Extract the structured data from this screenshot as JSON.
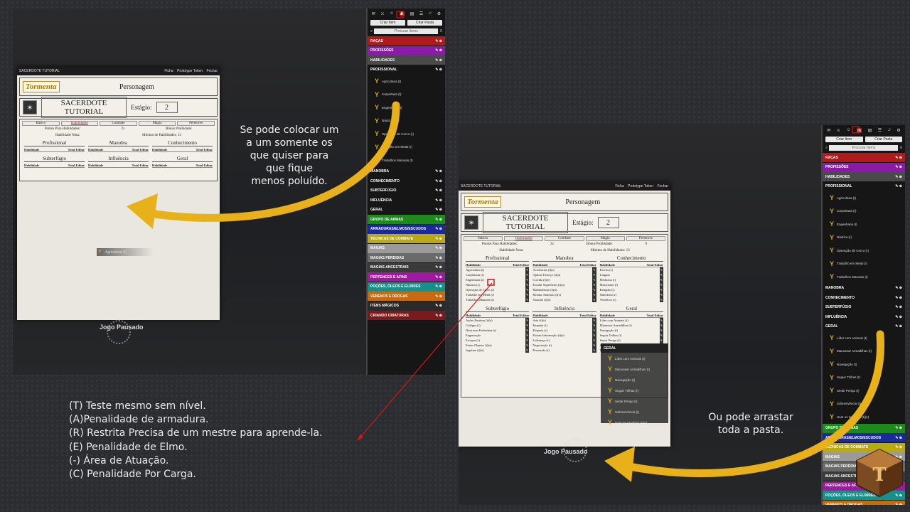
{
  "window": {
    "sheet_title": "SACERDOTE TUTORIAL",
    "actions": [
      "Ficha",
      "Prototype Token",
      "Fechar"
    ]
  },
  "sheet": {
    "logo": "Tormenta",
    "page_title": "Personagem",
    "char_name": "SACERDOTE TUTORIAL",
    "stage_label": "Estágio:",
    "stage_value": "2",
    "tabs": [
      "Básico",
      "Habilidades",
      "Combate",
      "Magia",
      "Pertences"
    ],
    "points_label": "Pontos Para Habilidades:",
    "points_value": "2x",
    "bonus_label": "Bônus Proibidade:",
    "bonus_value": "0",
    "skill_level_label": "Habilidade Nota:",
    "min_skills_label": "Mínimo de Habilidades: 13",
    "col_headers": [
      "Habilidade",
      "Total",
      "Editar"
    ],
    "groups": [
      {
        "title": "Profissional",
        "rows": [
          "Agricultura (t)",
          "Carpintaria (t)",
          "Engenharia (t)",
          "Náutica (r)",
          "Operação de Cerco (r)",
          "Trabalho em Metal (r)",
          "Trabalhos Manuais (t)"
        ]
      },
      {
        "title": "Manobra",
        "rows": [
          "Acrobacias (t)(a)",
          "Aplicar Esforço (t)(a)",
          "Corrida (t)(e)",
          "Escalar Superfícies (t)(a)",
          "Malabarismo (t)(a)",
          "Montar Animais (t)(e)",
          "Natação (t)(a)"
        ]
      },
      {
        "title": "Conhecimento",
        "rows": [
          "Escrita (r)",
          "Línguas",
          "Medicina (r)",
          "Musicismo (t)",
          "Religião (r)",
          "Sabedoria (r)",
          "Venefício (r)"
        ]
      },
      {
        "title": "Subterfúgio",
        "rows": [
          "Ações Furtivas (t)(a)",
          "Códigos (r)",
          "Destravar Fechadura (r)",
          "Engenração",
          "Escapar (r)",
          "Furtar Objetos (t)(a)",
          "Jogatina (t)(a)"
        ]
      },
      {
        "title": "Influência",
        "rows": [
          "Arte (t)(e)",
          "Empatia (t)",
          "Etiqueta (r)",
          "Extrair Informação (t)(e)",
          "Liderança (r)",
          "Negociação (t)",
          "Persuasão (t)"
        ]
      },
      {
        "title": "Geral",
        "rows": [
          "Líder com Animais (t)",
          "Manusear Armadilhas (t)",
          "Navegação (t)",
          "Seguir Trilhas (t)",
          "Sentir Perigo (t)",
          "Sobrevivência (t)",
          "Usar os Sentidos (t)"
        ]
      }
    ],
    "drag_item": "Agricultura (t)",
    "drag_folder": "GERAL"
  },
  "paused_text": "Jogo Pausado",
  "sidebar": {
    "create_item": "Criar Item",
    "create_folder": "Criar Pasta",
    "search_placeholder": "Procurar Items",
    "folders_top": [
      {
        "name": "RAÇAS",
        "color": "#b01a1a"
      },
      {
        "name": "PROFISSÕES",
        "color": "#8a1aa8"
      },
      {
        "name": "HABILIDADES",
        "color": "#4a4a4a"
      }
    ],
    "subfolder_open": "PROFISSIONAL",
    "professional_items": [
      "Agricultura (t)",
      "Carpintaria (t)",
      "Engenharia (t)",
      "Náutica (r)",
      "Operação de Cerco (r)",
      "Trabalho em Metal (r)",
      "Trabalhos Manuais (t)"
    ],
    "sub_folders": [
      "MANOBRA",
      "CONHECIMENTO",
      "SUBTERFÚGIO",
      "INFLUÊNCIA",
      "GERAL"
    ],
    "general_items": [
      "Líder com Animais (t)",
      "Manusear Armadilhas (t)",
      "Navegação (t)",
      "Seguir Trilhas (t)",
      "Sentir Perigo (t)",
      "Sobrevivência (t)",
      "Usar os Sentidos (t)(e)"
    ],
    "folders_bottom": [
      {
        "name": "GRUPO DE ARMAS",
        "color": "#1e8a1e"
      },
      {
        "name": "ARMADURAS/ELMOS/ESCUDOS",
        "color": "#1a2a9a"
      },
      {
        "name": "TÉCNICAS DE COMBATE",
        "color": "#b8aa10"
      },
      {
        "name": "MAGIAS",
        "color": "#9a9a9a"
      },
      {
        "name": "MAGIAS PERDIDAS",
        "color": "#6a6a6a"
      },
      {
        "name": "MAGIAS ANCESTRAIS",
        "color": "#3a3a3a"
      },
      {
        "name": "PERTENCES E AFINS",
        "color": "#a01aa0"
      },
      {
        "name": "POÇÕES, ÓLEOS E ELIXIRES",
        "color": "#15908a"
      },
      {
        "name": "VENENOS E DROGAS",
        "color": "#c86a10"
      },
      {
        "name": "ITENS MÁGICOS",
        "color": "#2a2a2a"
      },
      {
        "name": "CRIANDO CRIATURAS",
        "color": "#7a1a1a"
      }
    ]
  },
  "captions": {
    "left": [
      "Se pode colocar um",
      "a um somente os",
      "que quiser para",
      "que fique",
      "menos poluído."
    ],
    "right": [
      "Ou pode arrastar",
      "toda a pasta."
    ]
  },
  "legend": [
    "(T) Teste mesmo sem nível.",
    "(A)Penalidade de armadura.",
    "(R) Restrita Precisa de um mestre para aprende-la.",
    "(E) Penalidade de Elmo.",
    "(-) Área de Atuação.",
    "(C) Penalidade Por Carga."
  ],
  "colors": {
    "arrow": "#e8b11a",
    "pointer": "#d01818",
    "highlight": "#d01818"
  },
  "icons": [
    "chat-icon",
    "dice-icon",
    "journal-icon",
    "items-icon",
    "music-icon",
    "settings-icon",
    "search-icon",
    "axe-icon",
    "folder-icon"
  ]
}
